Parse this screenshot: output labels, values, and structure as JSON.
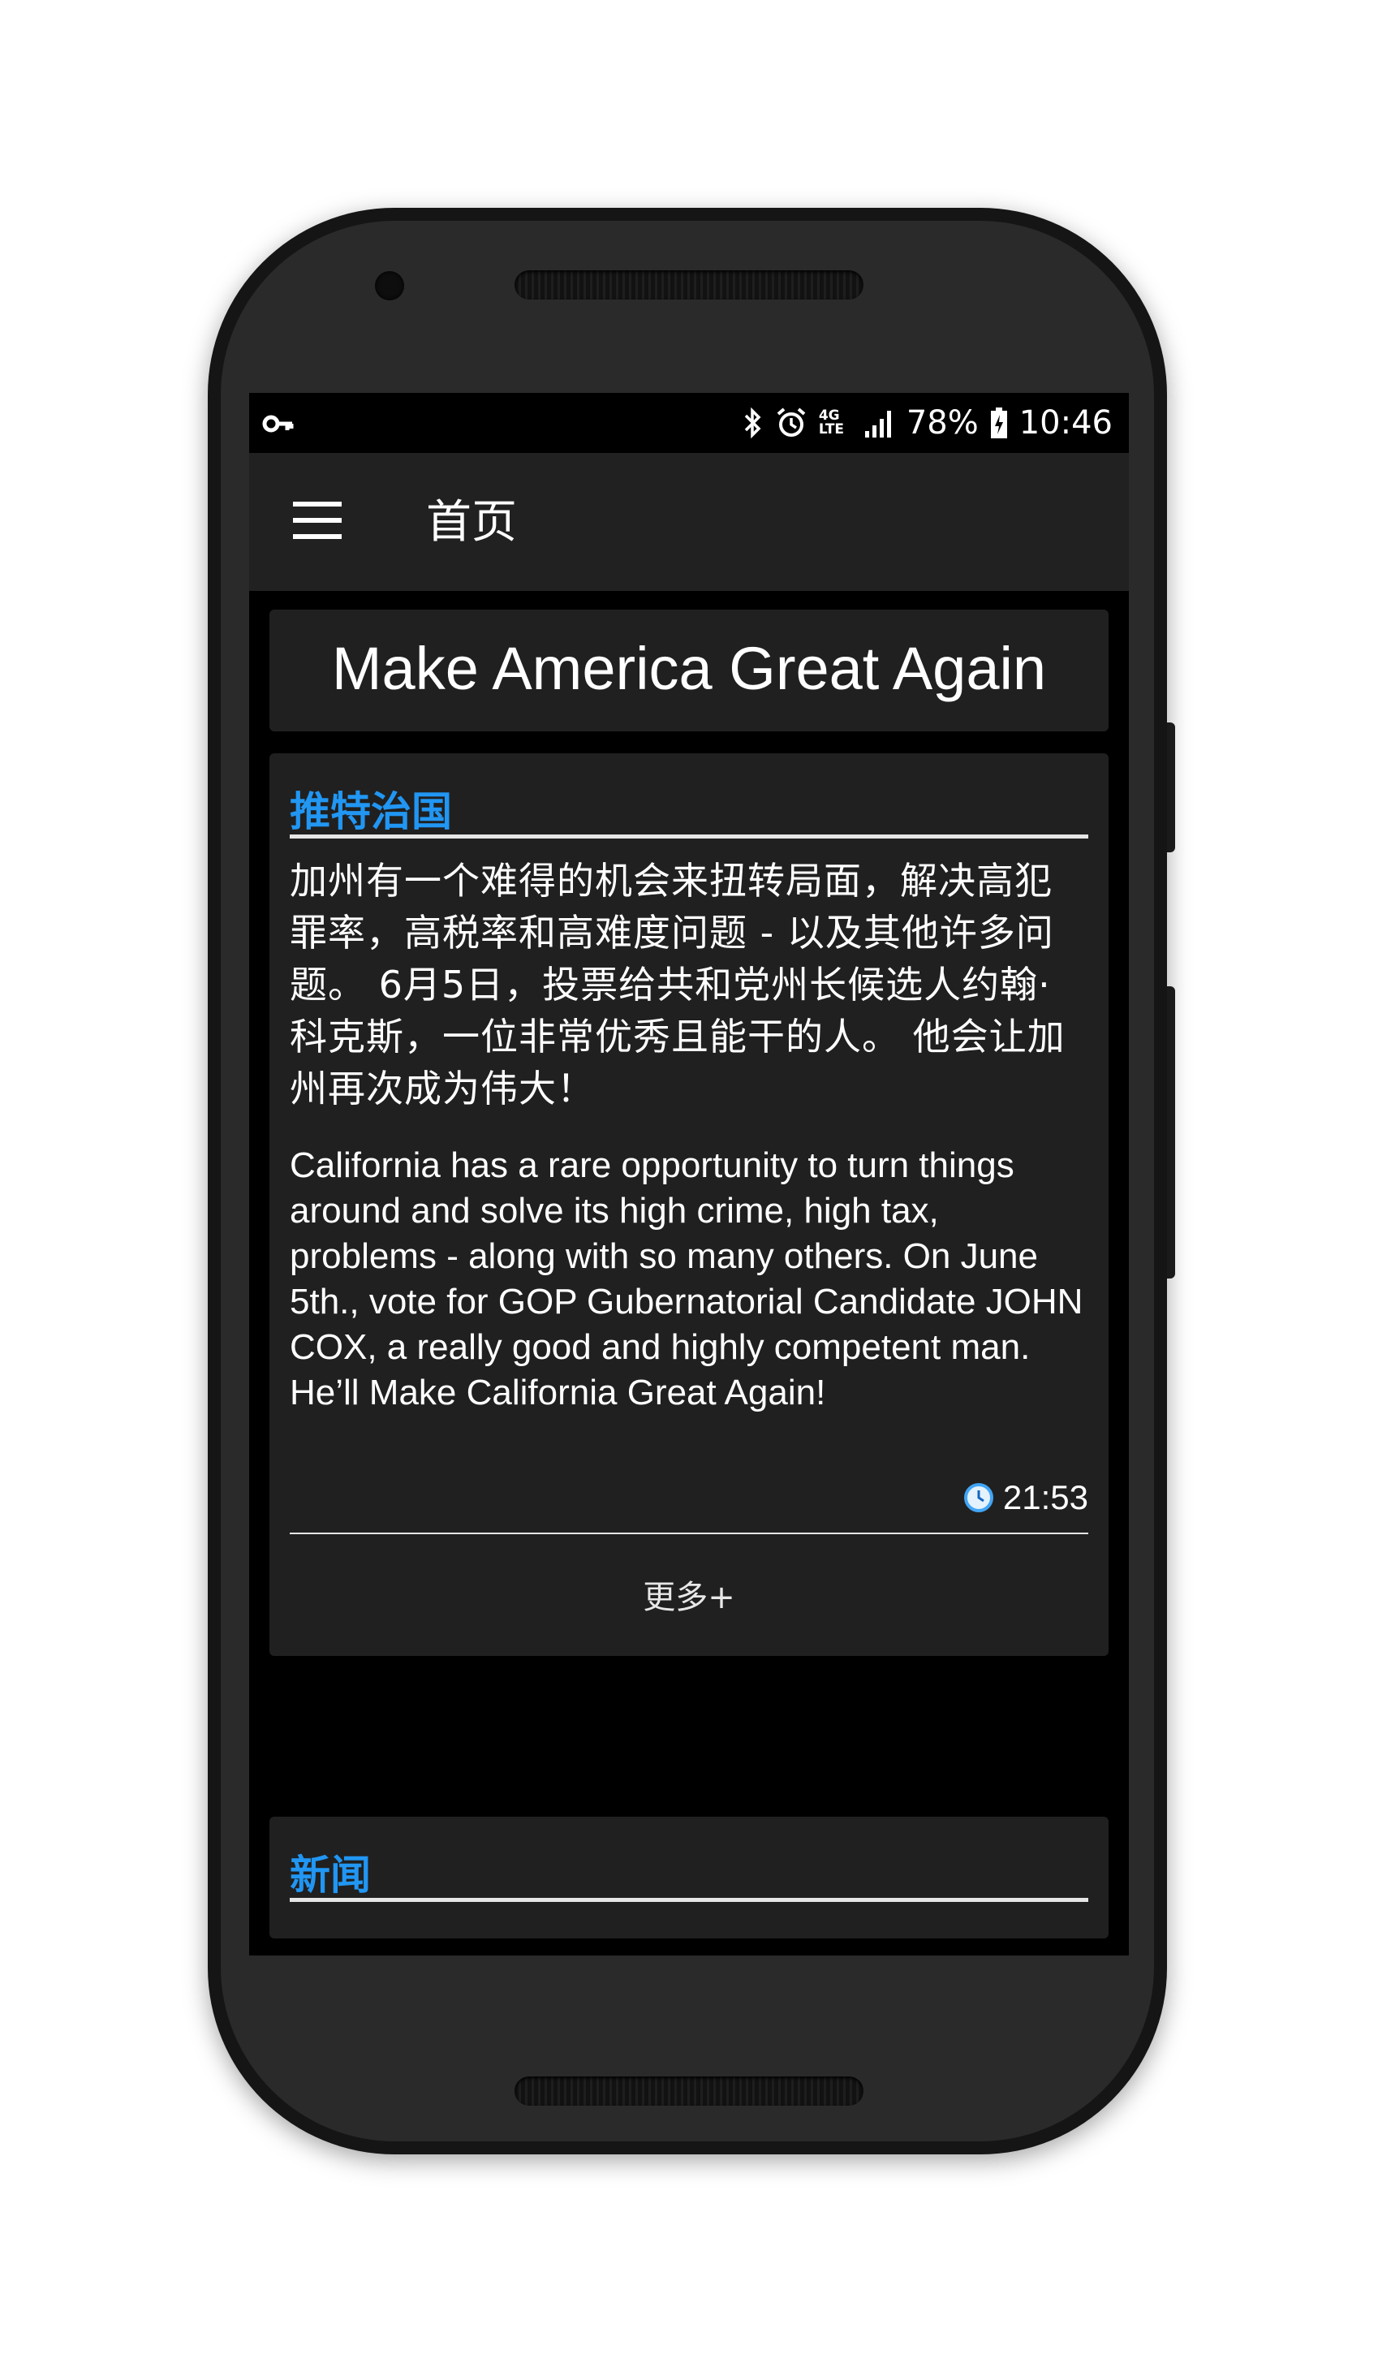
{
  "status_bar": {
    "battery": "78%",
    "time": "10:46",
    "network": "4G LTE"
  },
  "app_bar": {
    "title": "首页"
  },
  "banner": {
    "text": "Make America Great Again"
  },
  "tweet_section": {
    "title": "推特治国",
    "text_cn": "加州有一个难得的机会来扭转局面，解决高犯罪率，高税率和高难度问题 - 以及其他许多问题。 6月5日，投票给共和党州长候选人约翰·科克斯，一位非常优秀且能干的人。 他会让加州再次成为伟大！",
    "text_en": "California has a rare opportunity to turn things around and solve its high crime, high tax, problems - along with so many others. On June 5th., vote for GOP Gubernatorial Candidate JOHN COX, a really good and highly competent man. He’ll Make California Great Again!",
    "time": "21:53",
    "more_label": "更多+"
  },
  "news_section": {
    "title": "新闻"
  },
  "colors": {
    "accent": "#2196f3",
    "app_bar": "#212121",
    "card": "#202020",
    "screen_bg": "#000000"
  },
  "icons": [
    "key-icon",
    "bluetooth-icon",
    "alarm-icon",
    "signal-icon",
    "battery-icon",
    "menu-icon",
    "clock-icon"
  ]
}
